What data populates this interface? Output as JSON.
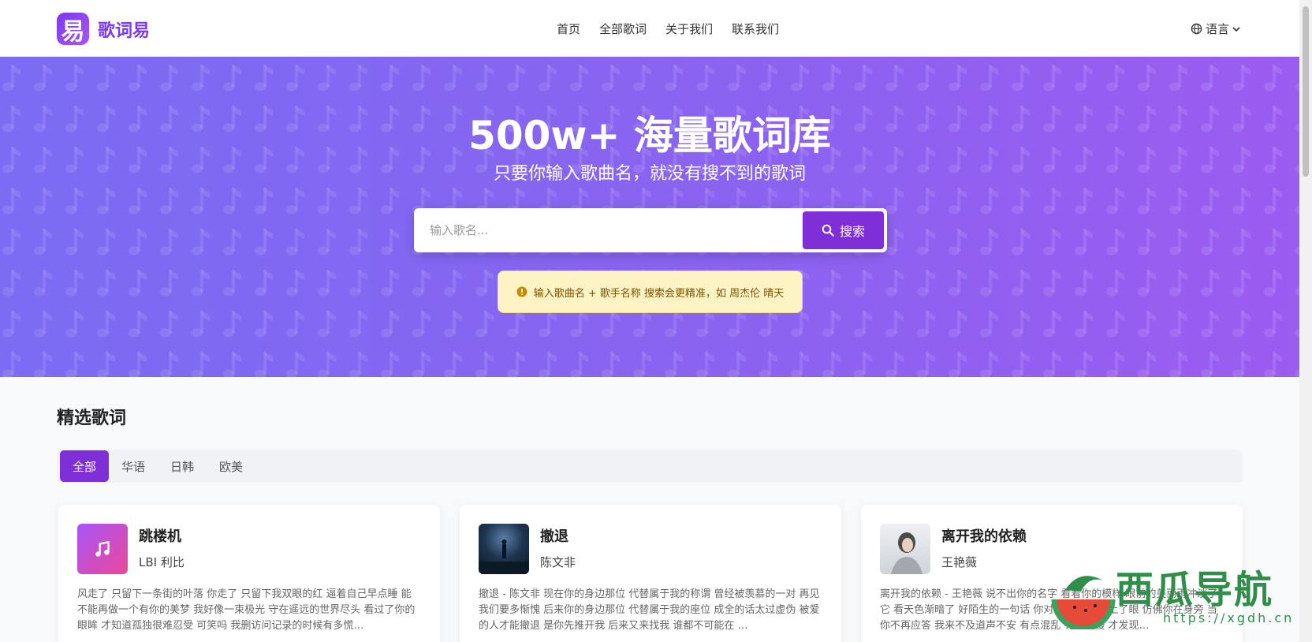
{
  "header": {
    "logo_char": "易",
    "logo_text": "歌词易",
    "nav": [
      "首页",
      "全部歌词",
      "关于我们",
      "联系我们"
    ],
    "language_label": "语言"
  },
  "hero": {
    "title": "500w+ 海量歌词库",
    "subtitle": "只要你输入歌曲名，就没有搜不到的歌词",
    "search_placeholder": "输入歌名...",
    "search_button": "搜索",
    "tip": "输入歌曲名 + 歌手名称 搜索会更精准，如 周杰伦 晴天"
  },
  "featured": {
    "title": "精选歌词",
    "tabs": [
      "全部",
      "华语",
      "日韩",
      "欧美"
    ],
    "active_tab": "全部",
    "cards": [
      {
        "title": "跳楼机",
        "artist": "LBI 利比",
        "excerpt": "风走了 只留下一条街的叶落 你走了 只留下我双眼的红 逼着自己早点睡 能不能再做一个有你的美梦 我好像一束极光 守在遥远的世界尽头 看过了你的眼眸 才知道孤独很难忍受 可笑吗 我删访问记录的时候有多慌…"
      },
      {
        "title": "撤退",
        "artist": "陈文非",
        "excerpt": "撤退 - 陈文非 现在你的身边那位 代替属于我的称谓 曾经被羡慕的一对 再见我们要多惭愧 后来你的身边那位 代替属于我的座位 成全的话太过虚伪 被爱的人才能撤退 是你先推开我 后来又来找我 谁都不可能在 …"
      },
      {
        "title": "离开我的依赖",
        "artist": "王艳薇",
        "excerpt": "离开我的依赖 - 王艳薇 说不出你的名字 看着你的模样 眼前的美丽雨冲淡了它 看天色渐暗了 好陌生的一句话 你对我说话 我蒙上了眼 仿佛你在身旁 当你不再应答 我来不及道声不安 有点混乱 有点缓慢 才发现…"
      }
    ]
  },
  "watermark": {
    "text": "西瓜导航",
    "url": "https://xgdh.cn"
  },
  "colors": {
    "brand": "#7e2fd8",
    "hero_start": "#7b6cf3",
    "hero_end": "#9b5cf0",
    "tip_bg": "#fdf3c4"
  }
}
